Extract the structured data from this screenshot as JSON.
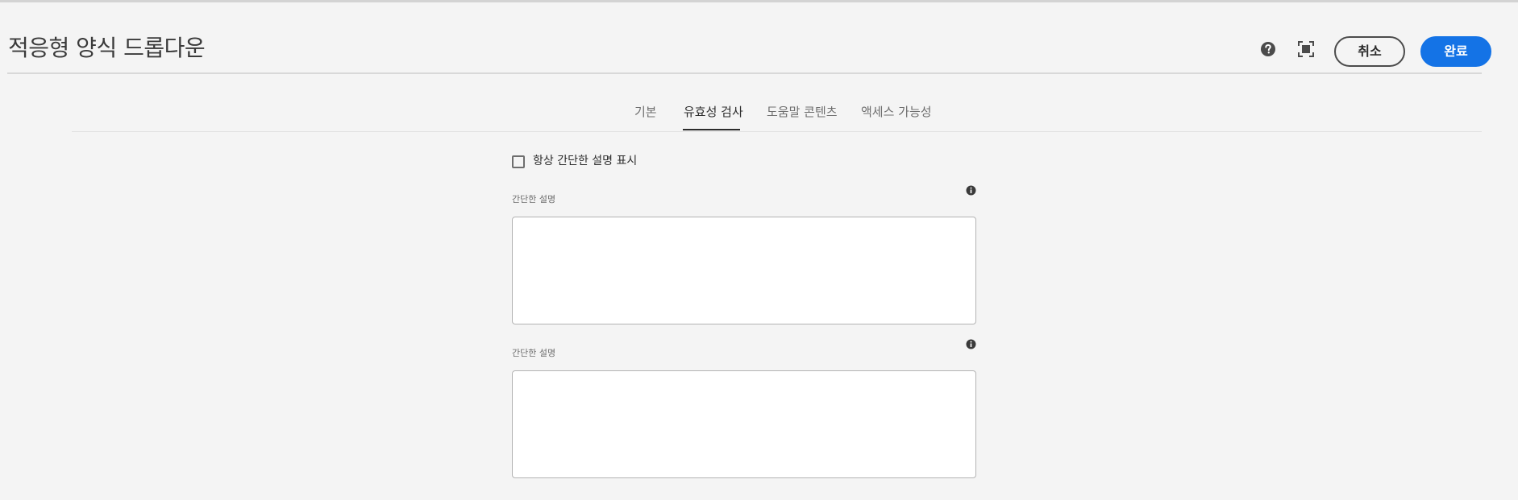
{
  "header": {
    "title": "적응형 양식 드롭다운",
    "help_icon": "help-circle-icon",
    "fullscreen_icon": "fullscreen-icon",
    "cancel_label": "취소",
    "done_label": "완료",
    "accent_color": "#1473e6"
  },
  "tabs": [
    {
      "label": "기본",
      "active": false
    },
    {
      "label": "유효성 검사",
      "active": true
    },
    {
      "label": "도움말 콘텐츠",
      "active": false
    },
    {
      "label": "액세스 가능성",
      "active": false
    }
  ],
  "form": {
    "always_show_short_desc": {
      "label": "항상 간단한 설명 표시",
      "checked": false
    },
    "fields": [
      {
        "label": "간단한 설명",
        "value": "",
        "info_icon": "info-icon"
      },
      {
        "label": "간단한 설명",
        "value": "",
        "info_icon": "info-icon"
      }
    ]
  }
}
